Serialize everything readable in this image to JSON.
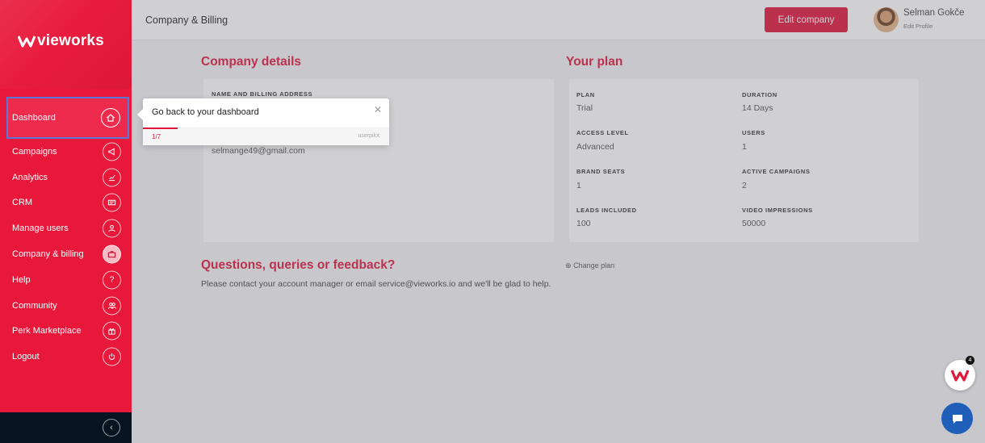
{
  "brand": {
    "name": "vieworks",
    "primary": "#e0163a",
    "sidebar": "#e8183a",
    "chat": "#1f5fba"
  },
  "header": {
    "title": "Company & Billing",
    "edit_company": "Edit company",
    "user_name": "Selman Gokče",
    "edit_profile": "Edit Profile"
  },
  "sidebar": {
    "items": [
      {
        "label": "Dashboard",
        "icon": "home-icon"
      },
      {
        "label": "Campaigns",
        "icon": "megaphone-icon"
      },
      {
        "label": "Analytics",
        "icon": "chart-icon"
      },
      {
        "label": "CRM",
        "icon": "card-icon"
      },
      {
        "label": "Manage users",
        "icon": "user-icon"
      },
      {
        "label": "Company & billing",
        "icon": "briefcase-icon"
      },
      {
        "label": "Help",
        "icon": "question-icon"
      },
      {
        "label": "Community",
        "icon": "users-icon"
      },
      {
        "label": "Perk Marketplace",
        "icon": "gift-icon"
      },
      {
        "label": "Logout",
        "icon": "power-icon"
      }
    ]
  },
  "company": {
    "title": "Company details",
    "address_label": "NAME AND BILLING ADDRESS",
    "email": "selmange49@gmail.com"
  },
  "plan": {
    "title": "Your plan",
    "fields": [
      {
        "label": "PLAN",
        "value": "Trial"
      },
      {
        "label": "DURATION",
        "value": "14 Days"
      },
      {
        "label": "ACCESS LEVEL",
        "value": "Advanced"
      },
      {
        "label": "USERS",
        "value": "1"
      },
      {
        "label": "BRAND SEATS",
        "value": "1"
      },
      {
        "label": "ACTIVE CAMPAIGNS",
        "value": "2"
      },
      {
        "label": "LEADS INCLUDED",
        "value": "100"
      },
      {
        "label": "VIDEO IMPRESSIONS",
        "value": "50000"
      }
    ],
    "change_plan": "Change plan"
  },
  "feedback": {
    "title": "Questions, queries or feedback?",
    "text": "Please contact your account manager or email service@vieworks.io and we'll be glad to help."
  },
  "tooltip": {
    "text": "Go back to your dashboard",
    "step": "1/7",
    "brand": "userpilot"
  },
  "float": {
    "count": "4"
  }
}
